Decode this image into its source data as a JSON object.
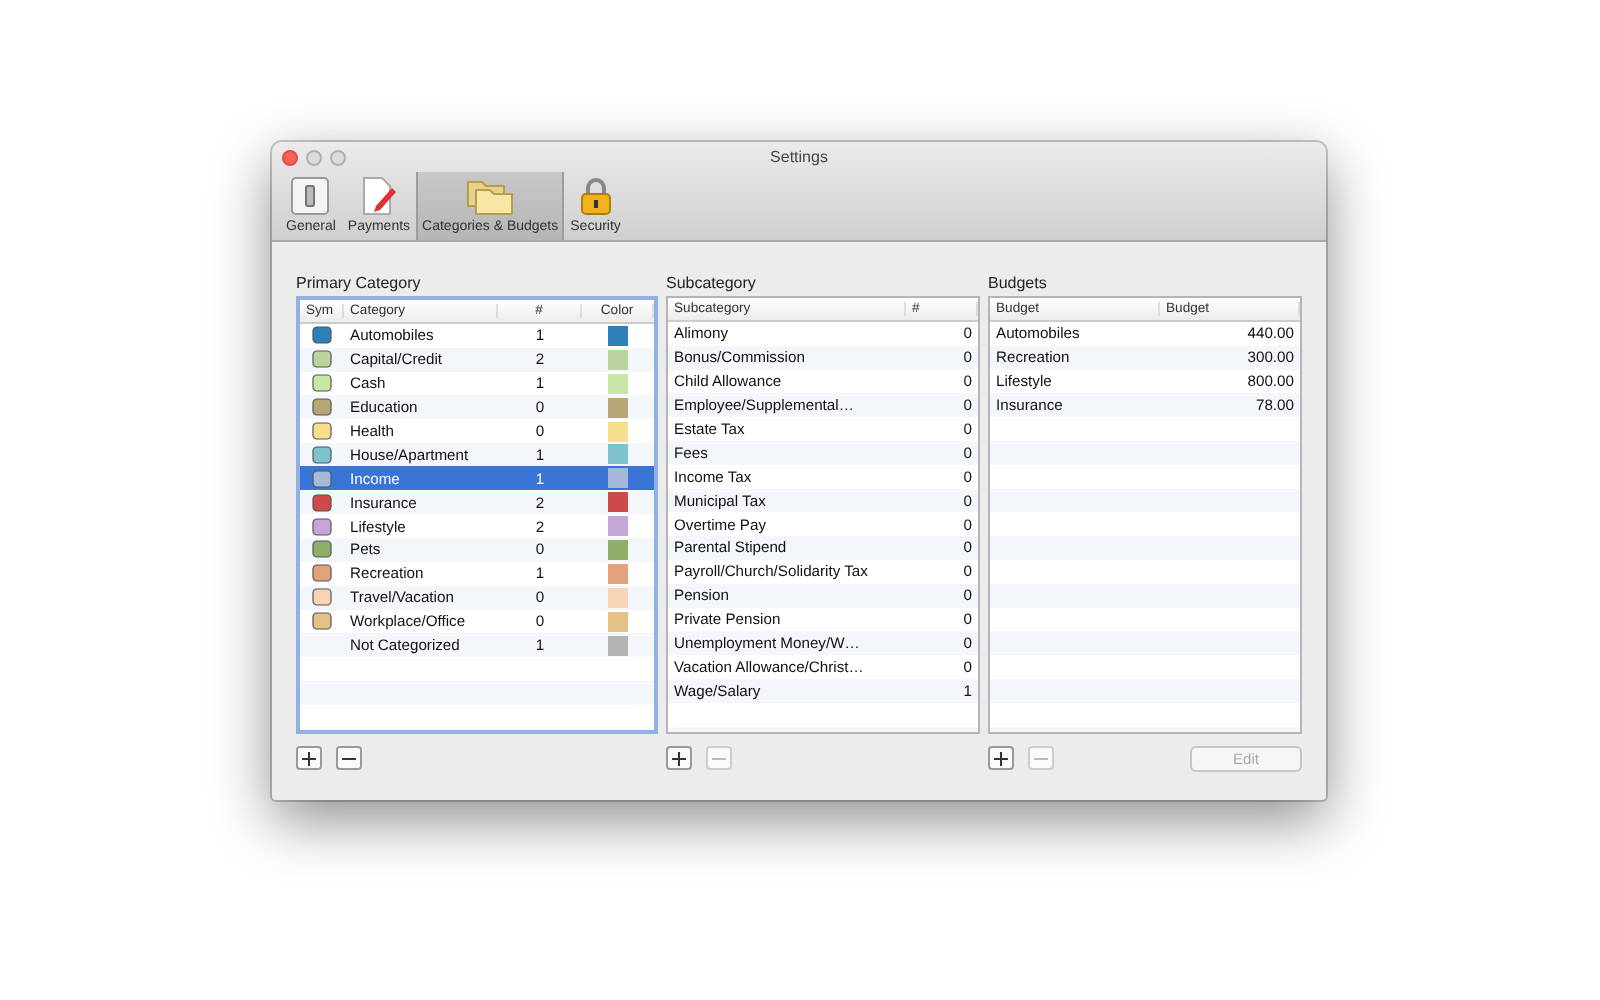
{
  "window": {
    "title": "Settings"
  },
  "toolbar": [
    {
      "label": "General",
      "kind": "general",
      "selected": false
    },
    {
      "label": "Payments",
      "kind": "payments",
      "selected": false
    },
    {
      "label": "Categories & Budgets",
      "kind": "folders",
      "selected": true
    },
    {
      "label": "Security",
      "kind": "lock",
      "selected": false
    }
  ],
  "primary": {
    "heading": "Primary Category",
    "columns": [
      "Sym",
      "Category",
      "#",
      "Color"
    ],
    "rows": [
      {
        "symbol": true,
        "name": "Automobiles",
        "count": "1",
        "color": "#2f7fb8",
        "selected": false
      },
      {
        "symbol": true,
        "name": "Capital/Credit",
        "count": "2",
        "color": "#bcd39e",
        "selected": false
      },
      {
        "symbol": true,
        "name": "Cash",
        "count": "1",
        "color": "#c9e6a4",
        "selected": false
      },
      {
        "symbol": true,
        "name": "Education",
        "count": "0",
        "color": "#b6a775",
        "selected": false
      },
      {
        "symbol": true,
        "name": "Health",
        "count": "0",
        "color": "#f7de8d",
        "selected": false
      },
      {
        "symbol": true,
        "name": "House/Apartment",
        "count": "1",
        "color": "#7fc3d0",
        "selected": false
      },
      {
        "symbol": true,
        "name": "Income",
        "count": "1",
        "color": "#a7b9d9",
        "selected": true
      },
      {
        "symbol": true,
        "name": "Insurance",
        "count": "2",
        "color": "#cd4a4a",
        "selected": false
      },
      {
        "symbol": true,
        "name": "Lifestyle",
        "count": "2",
        "color": "#c3a5d6",
        "selected": false
      },
      {
        "symbol": true,
        "name": "Pets",
        "count": "0",
        "color": "#8fae68",
        "selected": false
      },
      {
        "symbol": true,
        "name": "Recreation",
        "count": "1",
        "color": "#e3a27c",
        "selected": false
      },
      {
        "symbol": true,
        "name": "Travel/Vacation",
        "count": "0",
        "color": "#f6d4b5",
        "selected": false
      },
      {
        "symbol": true,
        "name": "Workplace/Office",
        "count": "0",
        "color": "#e4c286",
        "selected": false
      },
      {
        "symbol": false,
        "name": "Not Categorized",
        "count": "1",
        "color": "#b3b3b3",
        "selected": false
      }
    ],
    "add_disabled": false,
    "remove_disabled": false
  },
  "subcategory": {
    "heading": "Subcategory",
    "columns": [
      "Subcategory",
      "#"
    ],
    "rows": [
      {
        "name": "Alimony",
        "count": "0"
      },
      {
        "name": "Bonus/Commission",
        "count": "0"
      },
      {
        "name": "Child Allowance",
        "count": "0"
      },
      {
        "name": "Employee/Supplemental…",
        "count": "0"
      },
      {
        "name": "Estate Tax",
        "count": "0"
      },
      {
        "name": "Fees",
        "count": "0"
      },
      {
        "name": "Income Tax",
        "count": "0"
      },
      {
        "name": "Municipal Tax",
        "count": "0"
      },
      {
        "name": "Overtime Pay",
        "count": "0"
      },
      {
        "name": "Parental Stipend",
        "count": "0"
      },
      {
        "name": "Payroll/Church/Solidarity Tax",
        "count": "0"
      },
      {
        "name": "Pension",
        "count": "0"
      },
      {
        "name": "Private Pension",
        "count": "0"
      },
      {
        "name": "Unemployment Money/W…",
        "count": "0"
      },
      {
        "name": "Vacation Allowance/Christ…",
        "count": "0"
      },
      {
        "name": "Wage/Salary",
        "count": "1"
      }
    ],
    "add_disabled": false,
    "remove_disabled": true
  },
  "budgets": {
    "heading": "Budgets",
    "columns": [
      "Budget",
      "Budget"
    ],
    "rows": [
      {
        "name": "Automobiles",
        "amount": "440.00"
      },
      {
        "name": "Recreation",
        "amount": "300.00"
      },
      {
        "name": "Lifestyle",
        "amount": "800.00"
      },
      {
        "name": "Insurance",
        "amount": "78.00"
      }
    ],
    "add_disabled": false,
    "remove_disabled": true,
    "edit": {
      "label": "Edit",
      "disabled": true
    }
  }
}
